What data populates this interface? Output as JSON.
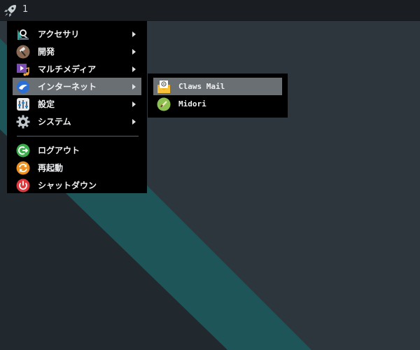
{
  "panel": {
    "launcher_icon": "rocket-icon",
    "workspace_label": "1"
  },
  "menu": {
    "items": [
      {
        "label": "アクセサリ",
        "icon": "accessories-icon",
        "has_submenu": true
      },
      {
        "label": "開発",
        "icon": "development-hammer-icon",
        "has_submenu": true
      },
      {
        "label": "マルチメディア",
        "icon": "multimedia-icon",
        "has_submenu": true
      },
      {
        "label": "インターネット",
        "icon": "internet-globe-icon",
        "has_submenu": true,
        "active": true
      },
      {
        "label": "設定",
        "icon": "settings-icon",
        "has_submenu": true
      },
      {
        "label": "システム",
        "icon": "system-gear-icon",
        "has_submenu": true
      }
    ],
    "actions": [
      {
        "label": "ログアウト",
        "icon": "logout-icon"
      },
      {
        "label": "再起動",
        "icon": "reboot-icon"
      },
      {
        "label": "シャットダウン",
        "icon": "power-icon"
      }
    ]
  },
  "submenu": {
    "items": [
      {
        "label": "Claws Mail",
        "icon": "mail-envelope-icon",
        "active": true
      },
      {
        "label": "Midori",
        "icon": "midori-browser-icon"
      }
    ]
  },
  "colors": {
    "desktop_bg": "#262d33",
    "teal_stripe": "#1d5558",
    "menu_bg": "#000000",
    "highlight": "#6a6f73"
  }
}
